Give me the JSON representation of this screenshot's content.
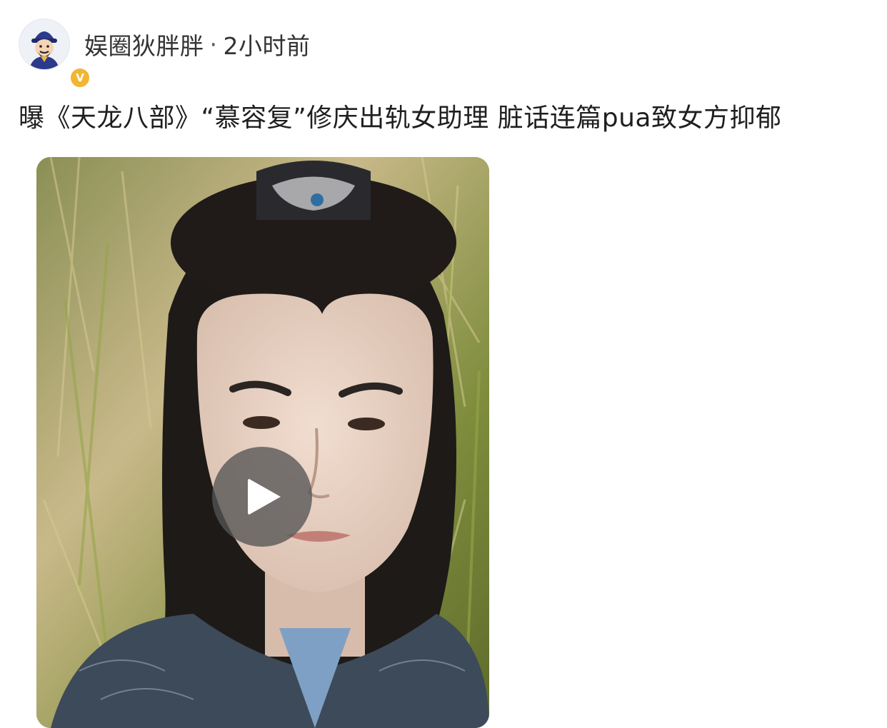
{
  "post": {
    "author": "娱圈狄胖胖",
    "separator": "·",
    "time": "2小时前",
    "title": "曝《天龙八部》“慕容复”修庆出轨女助理 脏话连篇pua致女方抑郁"
  },
  "icons": {
    "avatar": "cartoon-avatar-icon",
    "verified": "verified-v-icon",
    "play": "play-icon"
  },
  "badge": {
    "letter": "V"
  },
  "colors": {
    "verified_badge": "#f2b632",
    "play_overlay": "#555555"
  }
}
